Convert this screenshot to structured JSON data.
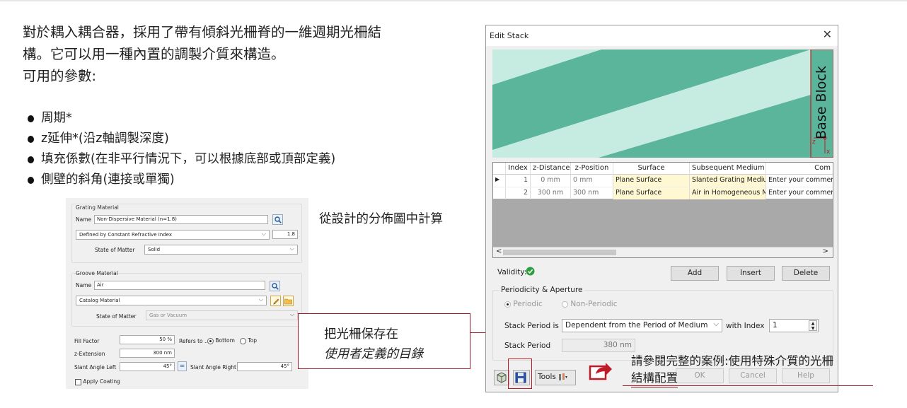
{
  "intro": {
    "line1": "對於耦入耦合器，採用了帶有傾斜光柵脊的一維週期光柵結",
    "line2": "構。它可以用一種內置的調製介質來構造。",
    "line3": "可用的參數:"
  },
  "bullets": [
    "周期*",
    "z延伸*(沿z軸調製深度)",
    "填充係數(在非平行情況下，可以根據底部或頂部定義)",
    "側壁的斜角(連接或單獨)"
  ],
  "calc_note": "從設計的分佈圖中計算",
  "grating_panel": {
    "grating_material": {
      "title": "Grating Material",
      "name_label": "Name",
      "name_value": "Non-Dispersive Material (n=1.8)",
      "definition": "Defined by Constant Refractive Index",
      "index_value": "1.8",
      "state_label": "State of Matter",
      "state_value": "Solid"
    },
    "groove_material": {
      "title": "Groove Material",
      "name_label": "Name",
      "name_value": "Air",
      "catalog": "Catalog Material",
      "state_label": "State of Matter",
      "state_value": "Gas or Vacuum"
    },
    "fill_factor_label": "Fill Factor",
    "fill_factor_value": "50 %",
    "refers_to_label": "Refers to ...",
    "bottom_label": "Bottom",
    "top_label": "Top",
    "z_extension_label": "z-Extension",
    "z_extension_value": "300 nm",
    "slant_left_label": "Slant Angle Left",
    "slant_left_value": "45°",
    "equal_label": "=",
    "slant_right_label": "Slant Angle Right",
    "slant_right_value": "45°",
    "apply_coating_label": "Apply Coating"
  },
  "callout_save": {
    "line1": "把光柵保存在",
    "line2": "使用者定義的目錄"
  },
  "edit_stack": {
    "title": "Edit Stack",
    "close": "✕",
    "scene_label": "Base Block",
    "axis_z": "z",
    "axis_x": "x",
    "columns": [
      "Index",
      "z-Distance",
      "z-Position",
      "Surface",
      "Subsequent Medium",
      "Com"
    ],
    "rows": [
      {
        "marker": "▶",
        "index": "1",
        "z_distance": "0 mm",
        "z_position": "0 mm",
        "surface": "Plane Surface",
        "medium": "Slanted Grating Mediu",
        "comment": "Enter your commen"
      },
      {
        "marker": "",
        "index": "2",
        "z_distance": "300 nm",
        "z_position": "300 nm",
        "surface": "Plane Surface",
        "medium": "Air in Homogeneous M",
        "comment": "Enter your commen"
      }
    ],
    "scroll_left": "<",
    "scroll_right": ">",
    "validity_label": "Validity:",
    "add_label": "Add",
    "insert_label": "Insert",
    "delete_label": "Delete",
    "periodicity_title": "Periodicity & Aperture",
    "periodic_label": "Periodic",
    "non_periodic_label": "Non-Periodic",
    "stack_period_label": "Stack Period is",
    "stack_period_value": "Dependent from the Period of Medium",
    "with_index_label": "with Index",
    "with_index_value": "1",
    "stack_period2_label": "Stack Period",
    "stack_period2_value": "380 nm",
    "tools_label": "Tools",
    "ok_label": "OK",
    "cancel_label": "Cancel",
    "help_label": "Help"
  },
  "callout_case": {
    "line1": "請參閱完整的案例:使用特殊介質的光柵",
    "line2": "結構配置"
  },
  "colors": {
    "accent_red": "#a11c2a",
    "grating_green": "#5bb59b",
    "light_green": "#c6ebe0"
  }
}
